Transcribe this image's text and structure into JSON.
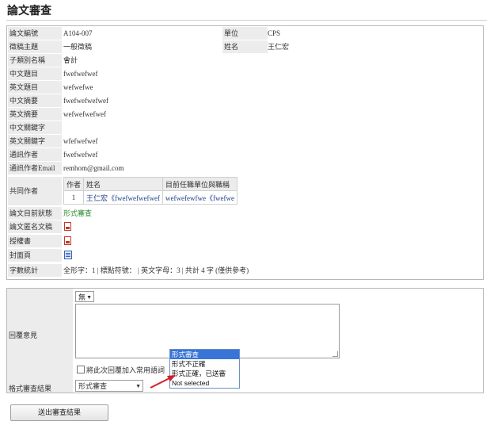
{
  "page_title": "論文審查",
  "info": {
    "rows": [
      {
        "label": "論文編號",
        "value": "A104-007"
      },
      {
        "label": "徵稿主題",
        "value": "一般徵稿"
      },
      {
        "label": "子類別名稱",
        "value": "會計"
      },
      {
        "label": "中文題目",
        "value": "fwefwefwef"
      },
      {
        "label": "英文題目",
        "value": "wefwefwe"
      },
      {
        "label": "中文摘要",
        "value": "fwefwefwefwef"
      },
      {
        "label": "英文摘要",
        "value": "wefwefwefwef"
      },
      {
        "label": "中文關鍵字",
        "value": ""
      },
      {
        "label": "英文關鍵字",
        "value": "wfefwefwef"
      },
      {
        "label": "通訊作者",
        "value": "fwefwefwef"
      },
      {
        "label": "通訊作者Email",
        "value": "remhom@gmail.com"
      }
    ],
    "unit_label": "單位",
    "unit_value": "CPS",
    "name_label": "姓名",
    "name_value": "王仁宏",
    "coauthors_label": "共同作者",
    "coauthors_headers": [
      "作者",
      "姓名",
      "目前任職單位與職稱"
    ],
    "coauthors": [
      {
        "no": "1",
        "name": "王仁宏《fwefwefwefwef",
        "org": "wefwefewfwe《fwefwe"
      }
    ],
    "status_label": "論文目前狀態",
    "status_value": "形式審查",
    "anon_doc_label": "論文匿名文稿",
    "auth_doc_label": "授權書",
    "cover_label": "封面頁",
    "wordcount_label": "字數統計",
    "wordcount_value": "全形字：1 | 標點符號： | 英文字母：3 | 共計 4 字 (僅供參考)"
  },
  "icons": {
    "anon_doc": "pdf-icon",
    "auth_doc": "pdf-icon",
    "cover": "word-doc-icon"
  },
  "reply": {
    "comment_label": "回覆意見",
    "template_select_value": "無",
    "comment_text": "",
    "save_phrase_label": "將此次回覆加入常用語詞",
    "result_label": "格式審查結果",
    "result_select_value": "形式審查",
    "result_options": [
      "形式審查",
      "形式不正確",
      "形式正確，已送審",
      "Not selected"
    ],
    "result_options_selected_index": 0
  },
  "submit_label": "送出審查結果",
  "colors": {
    "status_green": "#2d8a2d",
    "link_blue": "#1f3d8a",
    "label_bg": "#ececec",
    "dropdown_highlight": "#3875d7",
    "arrow_red": "#d0202a"
  }
}
